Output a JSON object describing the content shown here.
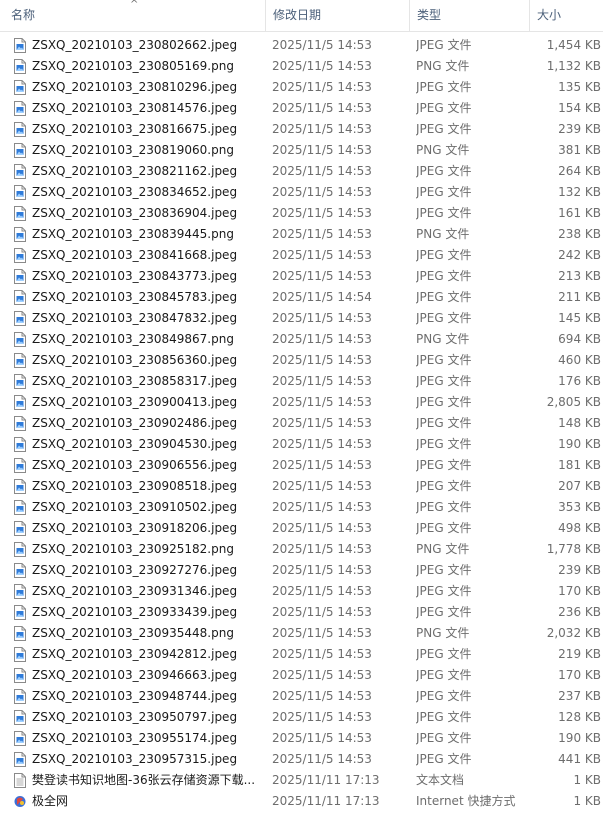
{
  "columns": {
    "name": "名称",
    "date": "修改日期",
    "type": "类型",
    "size": "大小"
  },
  "sort_indicator": "^",
  "files": [
    {
      "name": "ZSXQ_20210103_230802662.jpeg",
      "date": "2025/11/5 14:53",
      "type": "JPEG 文件",
      "size": "1,454 KB",
      "icon": "image-file-icon"
    },
    {
      "name": "ZSXQ_20210103_230805169.png",
      "date": "2025/11/5 14:53",
      "type": "PNG 文件",
      "size": "1,132 KB",
      "icon": "image-file-icon"
    },
    {
      "name": "ZSXQ_20210103_230810296.jpeg",
      "date": "2025/11/5 14:53",
      "type": "JPEG 文件",
      "size": "135 KB",
      "icon": "image-file-icon"
    },
    {
      "name": "ZSXQ_20210103_230814576.jpeg",
      "date": "2025/11/5 14:53",
      "type": "JPEG 文件",
      "size": "154 KB",
      "icon": "image-file-icon"
    },
    {
      "name": "ZSXQ_20210103_230816675.jpeg",
      "date": "2025/11/5 14:53",
      "type": "JPEG 文件",
      "size": "239 KB",
      "icon": "image-file-icon"
    },
    {
      "name": "ZSXQ_20210103_230819060.png",
      "date": "2025/11/5 14:53",
      "type": "PNG 文件",
      "size": "381 KB",
      "icon": "image-file-icon"
    },
    {
      "name": "ZSXQ_20210103_230821162.jpeg",
      "date": "2025/11/5 14:53",
      "type": "JPEG 文件",
      "size": "264 KB",
      "icon": "image-file-icon"
    },
    {
      "name": "ZSXQ_20210103_230834652.jpeg",
      "date": "2025/11/5 14:53",
      "type": "JPEG 文件",
      "size": "132 KB",
      "icon": "image-file-icon"
    },
    {
      "name": "ZSXQ_20210103_230836904.jpeg",
      "date": "2025/11/5 14:53",
      "type": "JPEG 文件",
      "size": "161 KB",
      "icon": "image-file-icon"
    },
    {
      "name": "ZSXQ_20210103_230839445.png",
      "date": "2025/11/5 14:53",
      "type": "PNG 文件",
      "size": "238 KB",
      "icon": "image-file-icon"
    },
    {
      "name": "ZSXQ_20210103_230841668.jpeg",
      "date": "2025/11/5 14:53",
      "type": "JPEG 文件",
      "size": "242 KB",
      "icon": "image-file-icon"
    },
    {
      "name": "ZSXQ_20210103_230843773.jpeg",
      "date": "2025/11/5 14:53",
      "type": "JPEG 文件",
      "size": "213 KB",
      "icon": "image-file-icon"
    },
    {
      "name": "ZSXQ_20210103_230845783.jpeg",
      "date": "2025/11/5 14:54",
      "type": "JPEG 文件",
      "size": "211 KB",
      "icon": "image-file-icon"
    },
    {
      "name": "ZSXQ_20210103_230847832.jpeg",
      "date": "2025/11/5 14:53",
      "type": "JPEG 文件",
      "size": "145 KB",
      "icon": "image-file-icon"
    },
    {
      "name": "ZSXQ_20210103_230849867.png",
      "date": "2025/11/5 14:53",
      "type": "PNG 文件",
      "size": "694 KB",
      "icon": "image-file-icon"
    },
    {
      "name": "ZSXQ_20210103_230856360.jpeg",
      "date": "2025/11/5 14:53",
      "type": "JPEG 文件",
      "size": "460 KB",
      "icon": "image-file-icon"
    },
    {
      "name": "ZSXQ_20210103_230858317.jpeg",
      "date": "2025/11/5 14:53",
      "type": "JPEG 文件",
      "size": "176 KB",
      "icon": "image-file-icon"
    },
    {
      "name": "ZSXQ_20210103_230900413.jpeg",
      "date": "2025/11/5 14:53",
      "type": "JPEG 文件",
      "size": "2,805 KB",
      "icon": "image-file-icon"
    },
    {
      "name": "ZSXQ_20210103_230902486.jpeg",
      "date": "2025/11/5 14:53",
      "type": "JPEG 文件",
      "size": "148 KB",
      "icon": "image-file-icon"
    },
    {
      "name": "ZSXQ_20210103_230904530.jpeg",
      "date": "2025/11/5 14:53",
      "type": "JPEG 文件",
      "size": "190 KB",
      "icon": "image-file-icon"
    },
    {
      "name": "ZSXQ_20210103_230906556.jpeg",
      "date": "2025/11/5 14:53",
      "type": "JPEG 文件",
      "size": "181 KB",
      "icon": "image-file-icon"
    },
    {
      "name": "ZSXQ_20210103_230908518.jpeg",
      "date": "2025/11/5 14:53",
      "type": "JPEG 文件",
      "size": "207 KB",
      "icon": "image-file-icon"
    },
    {
      "name": "ZSXQ_20210103_230910502.jpeg",
      "date": "2025/11/5 14:53",
      "type": "JPEG 文件",
      "size": "353 KB",
      "icon": "image-file-icon"
    },
    {
      "name": "ZSXQ_20210103_230918206.jpeg",
      "date": "2025/11/5 14:53",
      "type": "JPEG 文件",
      "size": "498 KB",
      "icon": "image-file-icon"
    },
    {
      "name": "ZSXQ_20210103_230925182.png",
      "date": "2025/11/5 14:53",
      "type": "PNG 文件",
      "size": "1,778 KB",
      "icon": "image-file-icon"
    },
    {
      "name": "ZSXQ_20210103_230927276.jpeg",
      "date": "2025/11/5 14:53",
      "type": "JPEG 文件",
      "size": "239 KB",
      "icon": "image-file-icon"
    },
    {
      "name": "ZSXQ_20210103_230931346.jpeg",
      "date": "2025/11/5 14:53",
      "type": "JPEG 文件",
      "size": "170 KB",
      "icon": "image-file-icon"
    },
    {
      "name": "ZSXQ_20210103_230933439.jpeg",
      "date": "2025/11/5 14:53",
      "type": "JPEG 文件",
      "size": "236 KB",
      "icon": "image-file-icon"
    },
    {
      "name": "ZSXQ_20210103_230935448.png",
      "date": "2025/11/5 14:53",
      "type": "PNG 文件",
      "size": "2,032 KB",
      "icon": "image-file-icon"
    },
    {
      "name": "ZSXQ_20210103_230942812.jpeg",
      "date": "2025/11/5 14:53",
      "type": "JPEG 文件",
      "size": "219 KB",
      "icon": "image-file-icon"
    },
    {
      "name": "ZSXQ_20210103_230946663.jpeg",
      "date": "2025/11/5 14:53",
      "type": "JPEG 文件",
      "size": "170 KB",
      "icon": "image-file-icon"
    },
    {
      "name": "ZSXQ_20210103_230948744.jpeg",
      "date": "2025/11/5 14:53",
      "type": "JPEG 文件",
      "size": "237 KB",
      "icon": "image-file-icon"
    },
    {
      "name": "ZSXQ_20210103_230950797.jpeg",
      "date": "2025/11/5 14:53",
      "type": "JPEG 文件",
      "size": "128 KB",
      "icon": "image-file-icon"
    },
    {
      "name": "ZSXQ_20210103_230955174.jpeg",
      "date": "2025/11/5 14:53",
      "type": "JPEG 文件",
      "size": "190 KB",
      "icon": "image-file-icon"
    },
    {
      "name": "ZSXQ_20210103_230957315.jpeg",
      "date": "2025/11/5 14:53",
      "type": "JPEG 文件",
      "size": "441 KB",
      "icon": "image-file-icon"
    },
    {
      "name": "樊登读书知识地图-36张云存储资源下载...",
      "date": "2025/11/11 17:13",
      "type": "文本文档",
      "size": "1 KB",
      "icon": "text-file-icon"
    },
    {
      "name": "极全网",
      "date": "2025/11/11 17:13",
      "type": "Internet 快捷方式",
      "size": "1 KB",
      "icon": "internet-shortcut-icon"
    }
  ],
  "colors": {
    "header_text": "#4c607a",
    "meta_text": "#6d6d6d",
    "name_text": "#1a1a1a",
    "image_icon_accent": "#2f7bd9",
    "shortcut_icon_accent": "#e0483e"
  }
}
